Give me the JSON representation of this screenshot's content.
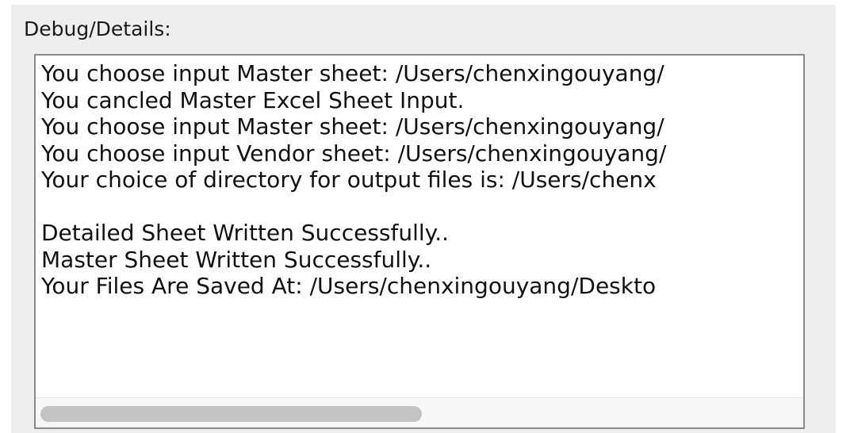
{
  "debug_panel": {
    "label": "Debug/Details:",
    "log_lines": [
      "You choose input Master sheet: /Users/chenxingouyang/",
      "You cancled Master Excel Sheet Input.",
      "You choose input Master sheet: /Users/chenxingouyang/",
      "You choose input Vendor sheet: /Users/chenxingouyang/",
      "Your choice of directory for output files is: /Users/chenx",
      "",
      "Detailed Sheet Written Successfully..",
      "Master Sheet Written Successfully..",
      "Your Files Are Saved At: /Users/chenxingouyang/Deskto"
    ],
    "horizontal_scroll_fraction": 0.0,
    "visible_width_fraction": 0.5
  }
}
